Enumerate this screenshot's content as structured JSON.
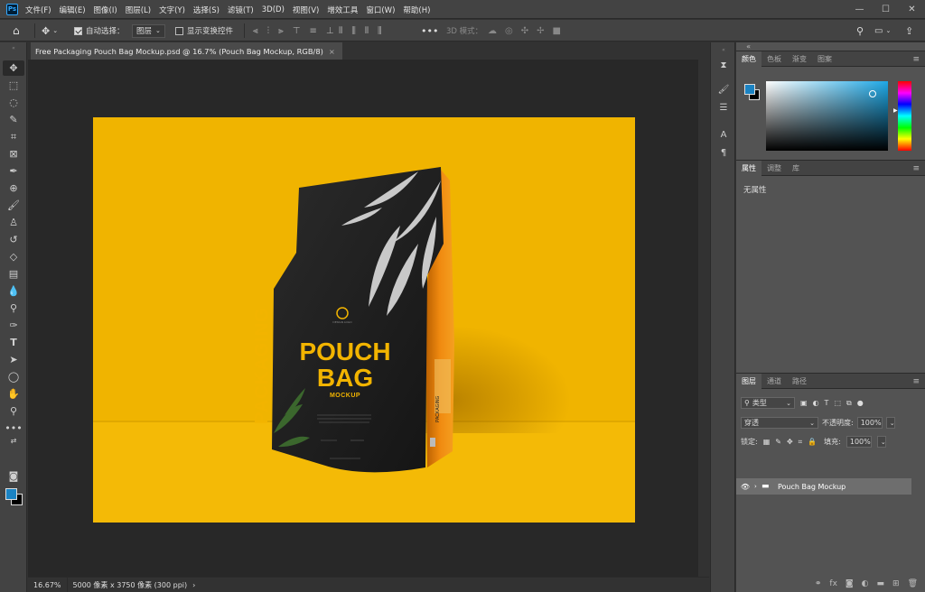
{
  "app": {
    "logo": "Ps"
  },
  "menubar": {
    "items": [
      "文件(F)",
      "编辑(E)",
      "图像(I)",
      "图层(L)",
      "文字(Y)",
      "选择(S)",
      "滤镜(T)",
      "3D(D)",
      "视图(V)",
      "增效工具",
      "窗口(W)",
      "帮助(H)"
    ],
    "window_controls": {
      "minimize": "—",
      "maximize": "☐",
      "close": "✕"
    }
  },
  "options": {
    "auto_select_label": "自动选择：",
    "auto_select_value": "图层",
    "show_transform_label": "显示变换控件",
    "mode_3d_label": "3D 模式："
  },
  "document": {
    "tab_title": "Free Packaging Pouch Bag Mockup.psd @ 16.7% (Pouch Bag Mockup, RGB/8)",
    "tab_close": "×"
  },
  "bag": {
    "vertical_text": "PACKAGING",
    "title_line1": "POUCH",
    "title_line2": "BAG",
    "subtitle": "MOCKUP",
    "mini_brand": "DESIGN LOGO",
    "side_label": "PACKAGING"
  },
  "status": {
    "zoom": "16.67%",
    "doc_info": "5000 像素 x 3750 像素 (300 ppi)",
    "arrow": "›"
  },
  "panels": {
    "color": {
      "tabs": [
        "颜色",
        "色板",
        "渐变",
        "图案"
      ],
      "fg": "#1b83c3",
      "bg": "#000000"
    },
    "properties": {
      "tabs": [
        "属性",
        "调整",
        "库"
      ],
      "empty_text": "无属性"
    },
    "layers": {
      "tabs": [
        "图层",
        "通道",
        "路径"
      ],
      "filter_kind": "类型",
      "blend_mode": "穿透",
      "opacity_label": "不透明度:",
      "opacity_value": "100%",
      "lock_label": "锁定:",
      "fill_label": "填充:",
      "fill_value": "100%",
      "layer_items": [
        {
          "name": "Pouch Bag Mockup",
          "type": "group"
        }
      ]
    }
  },
  "colors": {
    "accent": "#31a8ff",
    "canvas_bg": "#f0b400",
    "bag_text": "#f2b400",
    "bag_body": "#1c1c1c"
  }
}
